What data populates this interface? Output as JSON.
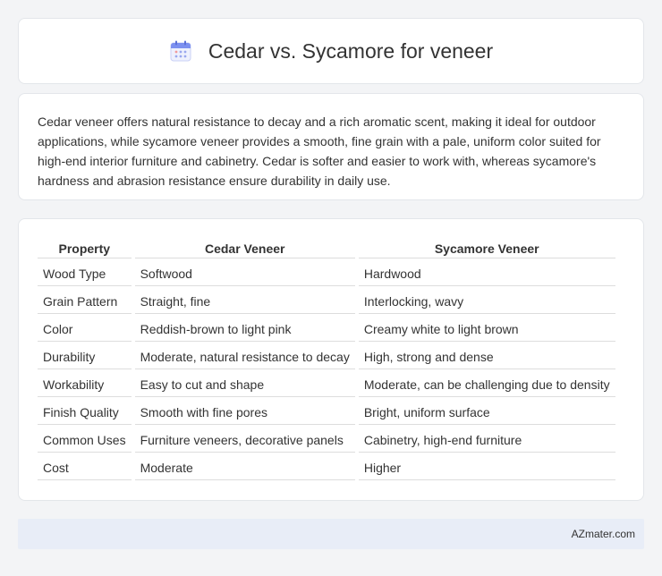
{
  "header": {
    "icon": "calendar-icon",
    "title": "Cedar vs. Sycamore for veneer"
  },
  "summary": {
    "text": "Cedar veneer offers natural resistance to decay and a rich aromatic scent, making it ideal for outdoor applications, while sycamore veneer provides a smooth, fine grain with a pale, uniform color suited for high-end interior furniture and cabinetry. Cedar is softer and easier to work with, whereas sycamore's hardness and abrasion resistance ensure durability in daily use."
  },
  "table": {
    "headers": [
      "Property",
      "Cedar Veneer",
      "Sycamore Veneer"
    ],
    "rows": [
      [
        "Wood Type",
        "Softwood",
        "Hardwood"
      ],
      [
        "Grain Pattern",
        "Straight, fine",
        "Interlocking, wavy"
      ],
      [
        "Color",
        "Reddish-brown to light pink",
        "Creamy white to light brown"
      ],
      [
        "Durability",
        "Moderate, natural resistance to decay",
        "High, strong and dense"
      ],
      [
        "Workability",
        "Easy to cut and shape",
        "Moderate, can be challenging due to density"
      ],
      [
        "Finish Quality",
        "Smooth with fine pores",
        "Bright, uniform surface"
      ],
      [
        "Common Uses",
        "Furniture veneers, decorative panels",
        "Cabinetry, high-end furniture"
      ],
      [
        "Cost",
        "Moderate",
        "Higher"
      ]
    ]
  },
  "footer": {
    "brand": "AZmater.com"
  },
  "colors": {
    "page_bg": "#f3f4f6",
    "card_bg": "#ffffff",
    "footer_bg": "#e8edf7",
    "icon_accent": "#7b8ff0"
  }
}
